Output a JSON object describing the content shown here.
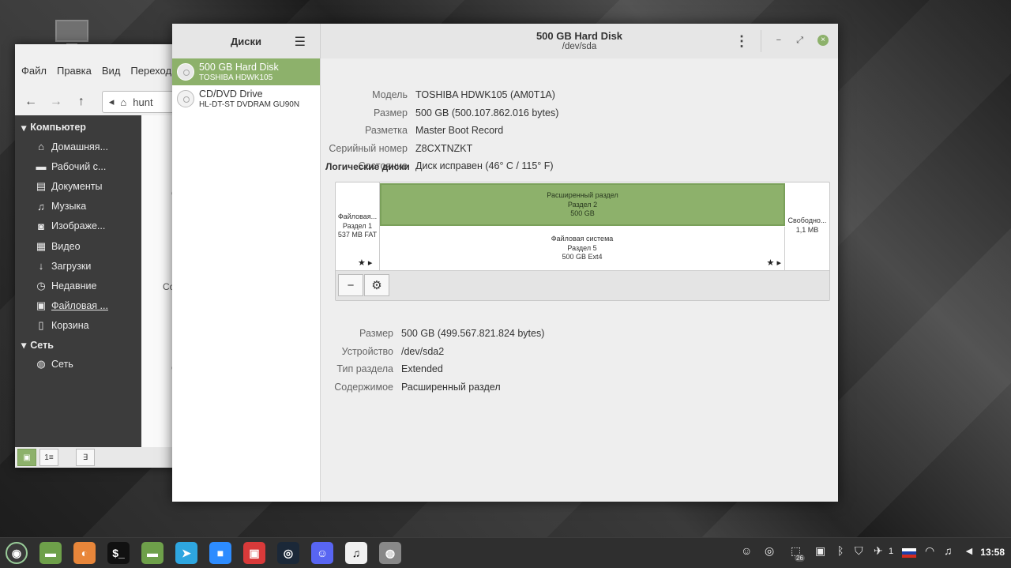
{
  "file_manager": {
    "menu": [
      "Файл",
      "Правка",
      "Вид",
      "Переход"
    ],
    "path_text": "hunt",
    "sections": [
      {
        "label": "Компьютер",
        "items": [
          {
            "label": "Домашняя...",
            "icon": "home-icon",
            "glyph": "⌂"
          },
          {
            "label": "Рабочий с...",
            "icon": "desktop-icon",
            "glyph": "▬"
          },
          {
            "label": "Документы",
            "icon": "document-icon",
            "glyph": "▤"
          },
          {
            "label": "Музыка",
            "icon": "music-icon",
            "glyph": "♫"
          },
          {
            "label": "Изображе...",
            "icon": "camera-icon",
            "glyph": "◙"
          },
          {
            "label": "Видео",
            "icon": "video-icon",
            "glyph": "▦"
          },
          {
            "label": "Загрузки",
            "icon": "download-icon",
            "glyph": "↓"
          },
          {
            "label": "Недавние",
            "icon": "recent-icon",
            "glyph": "◷"
          },
          {
            "label": "Файловая ...",
            "icon": "drive-icon",
            "glyph": "▣"
          },
          {
            "label": "Корзина",
            "icon": "trash-icon",
            "glyph": "▯"
          }
        ]
      },
      {
        "label": "Сеть",
        "items": [
          {
            "label": "Сеть",
            "icon": "network-icon",
            "glyph": "◍"
          }
        ]
      }
    ],
    "main_fragments": [
      "С",
      "Co",
      "С"
    ],
    "status_buttons": [
      "▣",
      "1≡",
      "∃"
    ]
  },
  "disks": {
    "sidebar_title": "Диски",
    "title": "500 GB Hard Disk",
    "subtitle": "/dev/sda",
    "devices": [
      {
        "name": "500 GB Hard Disk",
        "model": "TOSHIBA HDWK105",
        "selected": true
      },
      {
        "name": "CD/DVD Drive",
        "model": "HL-DT-ST DVDRAM GU90N",
        "selected": false
      }
    ],
    "info": [
      {
        "key": "Модель",
        "value": "TOSHIBA HDWK105 (AM0T1A)"
      },
      {
        "key": "Размер",
        "value": "500 GB (500.107.862.016 bytes)"
      },
      {
        "key": "Разметка",
        "value": "Master Boot Record"
      },
      {
        "key": "Серийный номер",
        "value": "Z8CXTNZKT"
      },
      {
        "key": "Состояние",
        "value": "Диск исправен (46° C / 115° F)"
      }
    ],
    "volumes_title": "Логические диски",
    "partitions": {
      "p1": [
        "Файловая...",
        "Раздел 1",
        "537 MB FAT"
      ],
      "ext": [
        "Расширенный раздел",
        "Раздел 2",
        "500 GB"
      ],
      "p5": [
        "Файловая система",
        "Раздел 5",
        "500 GB Ext4"
      ],
      "free": [
        "Свободно...",
        "1,1 MB"
      ]
    },
    "details": [
      {
        "key": "Размер",
        "value": "500 GB (499.567.821.824 bytes)"
      },
      {
        "key": "Устройство",
        "value": "/dev/sda2"
      },
      {
        "key": "Тип раздела",
        "value": "Extended"
      },
      {
        "key": "Содержимое",
        "value": "Расширенный раздел"
      }
    ],
    "tool_buttons": [
      "−",
      "⚙"
    ]
  },
  "taskbar": {
    "apps": [
      {
        "name": "mint-menu",
        "color": "#3a3a3a",
        "glyph": "◉"
      },
      {
        "name": "files-app",
        "color": "#6ea04a",
        "glyph": "▬"
      },
      {
        "name": "firefox-app",
        "color": "#e8863a",
        "glyph": "◐"
      },
      {
        "name": "terminal-app",
        "color": "#111111",
        "glyph": "$_"
      },
      {
        "name": "folder-app",
        "color": "#6ea04a",
        "glyph": "▬"
      },
      {
        "name": "telegram-app",
        "color": "#2ea6e0",
        "glyph": "➤"
      },
      {
        "name": "zoom-app",
        "color": "#2d8cff",
        "glyph": "■"
      },
      {
        "name": "software-manager-app",
        "color": "#d93a3a",
        "glyph": "▣"
      },
      {
        "name": "steam-app",
        "color": "#1b2838",
        "glyph": "◎"
      },
      {
        "name": "discord-app",
        "color": "#5865f2",
        "glyph": "☺"
      },
      {
        "name": "music-app",
        "color": "#f0f0f0",
        "glyph": "♫"
      },
      {
        "name": "disks-app",
        "color": "#888888",
        "glyph": "◍"
      }
    ],
    "tray": [
      {
        "name": "discord-tray-icon",
        "glyph": "☺"
      },
      {
        "name": "steam-tray-icon",
        "glyph": "◎"
      },
      {
        "name": "update-tray-icon",
        "glyph": "⬚"
      },
      {
        "name": "updates-count-badge",
        "glyph": "26"
      },
      {
        "name": "software-tray-icon",
        "glyph": "▣"
      },
      {
        "name": "bluetooth-icon",
        "glyph": "ᛒ"
      },
      {
        "name": "shield-icon",
        "glyph": "⛉"
      },
      {
        "name": "notifications-icon",
        "glyph": "✈"
      },
      {
        "name": "notifications-count",
        "glyph": "1"
      },
      {
        "name": "keyboard-layout-flag",
        "glyph": ""
      },
      {
        "name": "wifi-icon",
        "glyph": "◠"
      },
      {
        "name": "music-tray-icon",
        "glyph": "♫"
      },
      {
        "name": "volume-icon",
        "glyph": "◄"
      }
    ],
    "clock": "13:58"
  }
}
